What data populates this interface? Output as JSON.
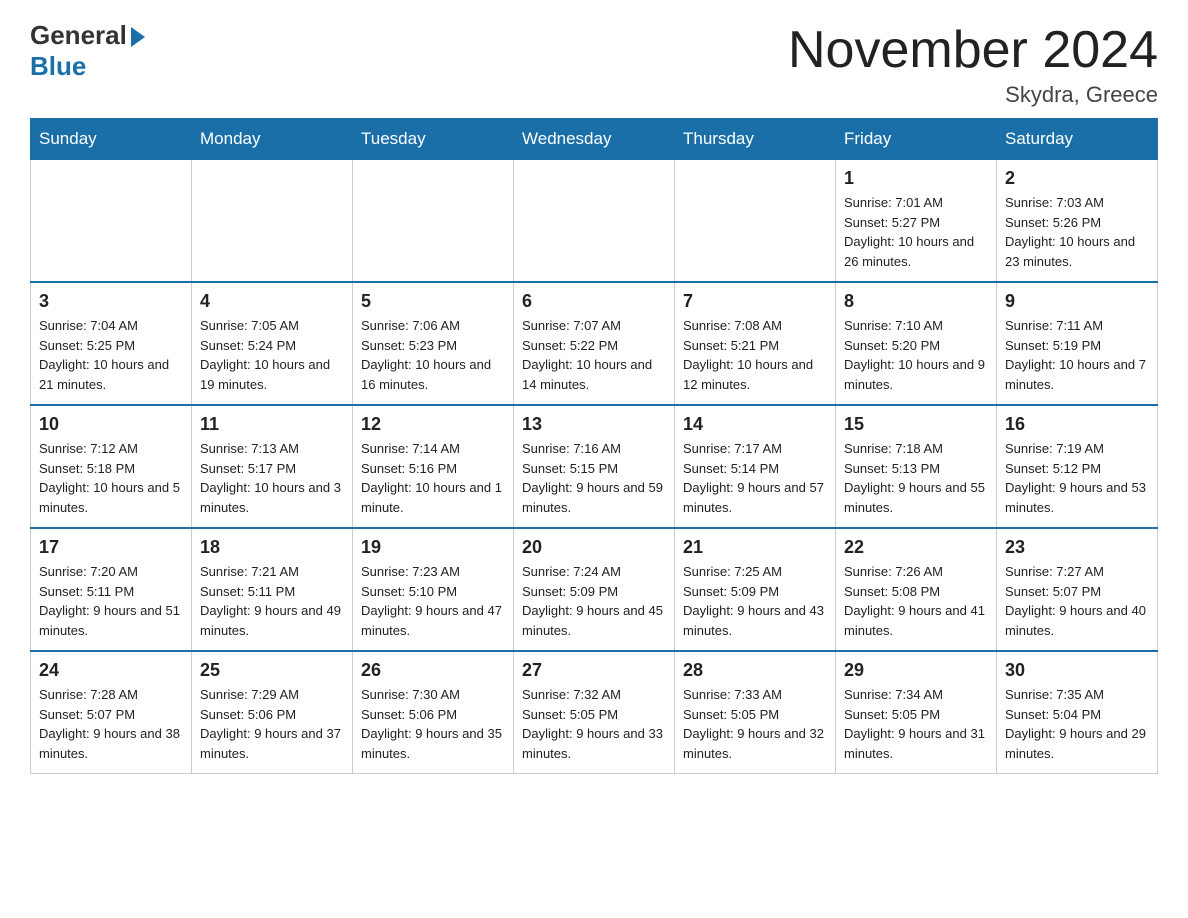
{
  "logo": {
    "general": "General",
    "blue": "Blue"
  },
  "header": {
    "title": "November 2024",
    "location": "Skydra, Greece"
  },
  "days_of_week": [
    "Sunday",
    "Monday",
    "Tuesday",
    "Wednesday",
    "Thursday",
    "Friday",
    "Saturday"
  ],
  "weeks": [
    [
      {
        "day": "",
        "info": ""
      },
      {
        "day": "",
        "info": ""
      },
      {
        "day": "",
        "info": ""
      },
      {
        "day": "",
        "info": ""
      },
      {
        "day": "",
        "info": ""
      },
      {
        "day": "1",
        "info": "Sunrise: 7:01 AM\nSunset: 5:27 PM\nDaylight: 10 hours and 26 minutes."
      },
      {
        "day": "2",
        "info": "Sunrise: 7:03 AM\nSunset: 5:26 PM\nDaylight: 10 hours and 23 minutes."
      }
    ],
    [
      {
        "day": "3",
        "info": "Sunrise: 7:04 AM\nSunset: 5:25 PM\nDaylight: 10 hours and 21 minutes."
      },
      {
        "day": "4",
        "info": "Sunrise: 7:05 AM\nSunset: 5:24 PM\nDaylight: 10 hours and 19 minutes."
      },
      {
        "day": "5",
        "info": "Sunrise: 7:06 AM\nSunset: 5:23 PM\nDaylight: 10 hours and 16 minutes."
      },
      {
        "day": "6",
        "info": "Sunrise: 7:07 AM\nSunset: 5:22 PM\nDaylight: 10 hours and 14 minutes."
      },
      {
        "day": "7",
        "info": "Sunrise: 7:08 AM\nSunset: 5:21 PM\nDaylight: 10 hours and 12 minutes."
      },
      {
        "day": "8",
        "info": "Sunrise: 7:10 AM\nSunset: 5:20 PM\nDaylight: 10 hours and 9 minutes."
      },
      {
        "day": "9",
        "info": "Sunrise: 7:11 AM\nSunset: 5:19 PM\nDaylight: 10 hours and 7 minutes."
      }
    ],
    [
      {
        "day": "10",
        "info": "Sunrise: 7:12 AM\nSunset: 5:18 PM\nDaylight: 10 hours and 5 minutes."
      },
      {
        "day": "11",
        "info": "Sunrise: 7:13 AM\nSunset: 5:17 PM\nDaylight: 10 hours and 3 minutes."
      },
      {
        "day": "12",
        "info": "Sunrise: 7:14 AM\nSunset: 5:16 PM\nDaylight: 10 hours and 1 minute."
      },
      {
        "day": "13",
        "info": "Sunrise: 7:16 AM\nSunset: 5:15 PM\nDaylight: 9 hours and 59 minutes."
      },
      {
        "day": "14",
        "info": "Sunrise: 7:17 AM\nSunset: 5:14 PM\nDaylight: 9 hours and 57 minutes."
      },
      {
        "day": "15",
        "info": "Sunrise: 7:18 AM\nSunset: 5:13 PM\nDaylight: 9 hours and 55 minutes."
      },
      {
        "day": "16",
        "info": "Sunrise: 7:19 AM\nSunset: 5:12 PM\nDaylight: 9 hours and 53 minutes."
      }
    ],
    [
      {
        "day": "17",
        "info": "Sunrise: 7:20 AM\nSunset: 5:11 PM\nDaylight: 9 hours and 51 minutes."
      },
      {
        "day": "18",
        "info": "Sunrise: 7:21 AM\nSunset: 5:11 PM\nDaylight: 9 hours and 49 minutes."
      },
      {
        "day": "19",
        "info": "Sunrise: 7:23 AM\nSunset: 5:10 PM\nDaylight: 9 hours and 47 minutes."
      },
      {
        "day": "20",
        "info": "Sunrise: 7:24 AM\nSunset: 5:09 PM\nDaylight: 9 hours and 45 minutes."
      },
      {
        "day": "21",
        "info": "Sunrise: 7:25 AM\nSunset: 5:09 PM\nDaylight: 9 hours and 43 minutes."
      },
      {
        "day": "22",
        "info": "Sunrise: 7:26 AM\nSunset: 5:08 PM\nDaylight: 9 hours and 41 minutes."
      },
      {
        "day": "23",
        "info": "Sunrise: 7:27 AM\nSunset: 5:07 PM\nDaylight: 9 hours and 40 minutes."
      }
    ],
    [
      {
        "day": "24",
        "info": "Sunrise: 7:28 AM\nSunset: 5:07 PM\nDaylight: 9 hours and 38 minutes."
      },
      {
        "day": "25",
        "info": "Sunrise: 7:29 AM\nSunset: 5:06 PM\nDaylight: 9 hours and 37 minutes."
      },
      {
        "day": "26",
        "info": "Sunrise: 7:30 AM\nSunset: 5:06 PM\nDaylight: 9 hours and 35 minutes."
      },
      {
        "day": "27",
        "info": "Sunrise: 7:32 AM\nSunset: 5:05 PM\nDaylight: 9 hours and 33 minutes."
      },
      {
        "day": "28",
        "info": "Sunrise: 7:33 AM\nSunset: 5:05 PM\nDaylight: 9 hours and 32 minutes."
      },
      {
        "day": "29",
        "info": "Sunrise: 7:34 AM\nSunset: 5:05 PM\nDaylight: 9 hours and 31 minutes."
      },
      {
        "day": "30",
        "info": "Sunrise: 7:35 AM\nSunset: 5:04 PM\nDaylight: 9 hours and 29 minutes."
      }
    ]
  ]
}
